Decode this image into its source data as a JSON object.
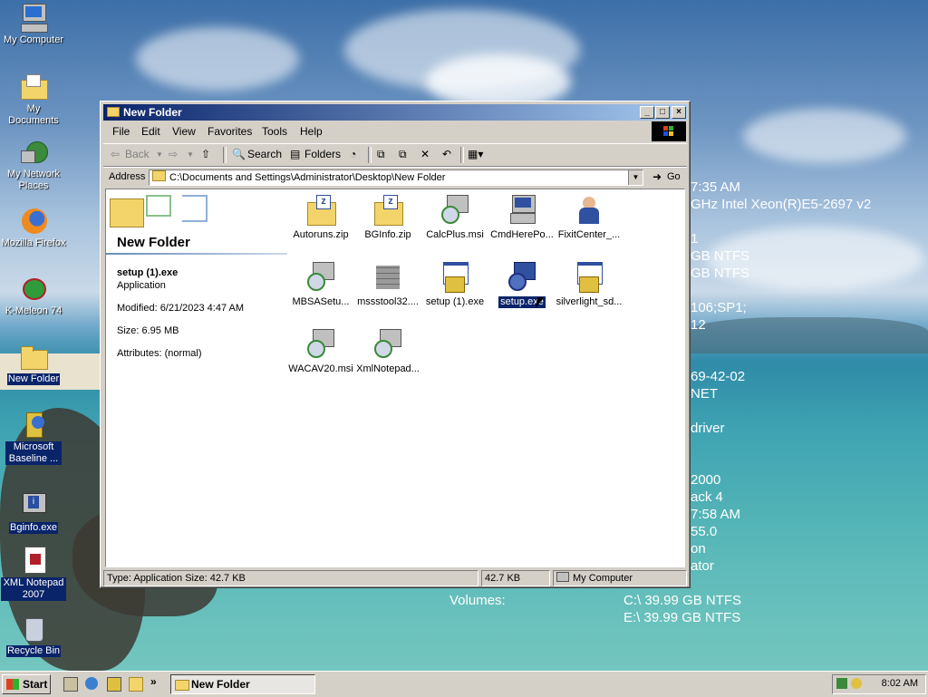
{
  "desktop": {
    "icons": [
      {
        "label": "My Computer"
      },
      {
        "label": "My Documents"
      },
      {
        "label": "My Network Places"
      },
      {
        "label": "Mozilla Firefox"
      },
      {
        "label": "K-Meleon 74"
      },
      {
        "label": "New Folder"
      },
      {
        "label": "Microsoft Baseline ..."
      },
      {
        "label": "Bginfo.exe"
      },
      {
        "label": "XML Notepad 2007"
      },
      {
        "label": "Recycle Bin"
      }
    ],
    "bginfo_lines": [
      "7:35 AM",
      "GHz Intel Xeon(R)E5-2697 v2",
      "",
      "1",
      "GB NTFS",
      "GB NTFS",
      "",
      "106;SP1;",
      "12",
      "",
      "",
      "69-42-02",
      "NET",
      "",
      "driver",
      "",
      "",
      "2000",
      "ack 4",
      "7:58 AM",
      "55.0",
      "on",
      "ator"
    ],
    "volumes_label": "Volumes:",
    "volumes_values": [
      "C:\\ 39.99 GB NTFS",
      "E:\\ 39.99 GB NTFS"
    ]
  },
  "window": {
    "title": "New Folder",
    "menu": [
      "File",
      "Edit",
      "View",
      "Favorites",
      "Tools",
      "Help"
    ],
    "toolbar": {
      "back": "Back",
      "search": "Search",
      "folders": "Folders"
    },
    "address": {
      "label": "Address",
      "value": "C:\\Documents and Settings\\Administrator\\Desktop\\New Folder",
      "go": "Go"
    },
    "panel": {
      "folder_name": "New Folder",
      "selected_name": "setup (1).exe",
      "selected_type": "Application",
      "modified": "Modified: 6/21/2023 4:47 AM",
      "size": "Size: 6.95 MB",
      "attributes": "Attributes: (normal)"
    },
    "files": [
      {
        "label": "Autoruns.zip",
        "icon": "zip-folder-icon"
      },
      {
        "label": "BGInfo.zip",
        "icon": "zip-folder-icon"
      },
      {
        "label": "CalcPlus.msi",
        "icon": "installer-icon"
      },
      {
        "label": "CmdHerePo...",
        "icon": "installer-pc-icon"
      },
      {
        "label": "FixitCenter_...",
        "icon": "wrench-man-icon"
      },
      {
        "label": "MBSASetu...",
        "icon": "installer-icon"
      },
      {
        "label": "mssstool32....",
        "icon": "brick-wall-icon"
      },
      {
        "label": "setup (1).exe",
        "icon": "setup-window-icon"
      },
      {
        "label": "setup.exe",
        "icon": "setup-disk-icon"
      },
      {
        "label": "silverlight_sd...",
        "icon": "setup-window-icon"
      },
      {
        "label": "WACAV20.msi",
        "icon": "installer-icon"
      },
      {
        "label": "XmlNotepad...",
        "icon": "installer-icon"
      }
    ],
    "status": {
      "left": "Type: Application Size: 42.7 KB",
      "size": "42.7 KB",
      "zone": "My Computer"
    }
  },
  "taskbar": {
    "start": "Start",
    "task": "New Folder",
    "clock": "8:02 AM"
  },
  "colors": {
    "titlebar": "#0a246a",
    "selection": "#0a246a",
    "face": "#d4d0c8"
  }
}
